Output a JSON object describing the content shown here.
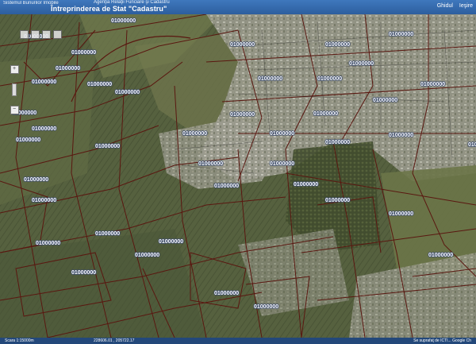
{
  "header": {
    "left_text": "Sistemul Bunurilor Imobile",
    "agency": "Agenţia Relaţii Funciare şi Cadastru",
    "title": "Întreprinderea de Stat \"Cadastru\"",
    "links": [
      "Ghidul",
      "Ieşire"
    ]
  },
  "map": {
    "imagery_colors": {
      "field_dark": "#4f5b3e",
      "field_light": "#7d8456",
      "urban": "#a7a79d",
      "forest": "#3f4a2c",
      "boundary": "#5a1710"
    },
    "parcel_labels": [
      "01000000",
      "01000000",
      "01000000",
      "01000000",
      "01000000",
      "01000000",
      "01000000",
      "01000000",
      "01000000",
      "01000000",
      "01000000",
      "01000000",
      "01000000",
      "01000000",
      "01000000",
      "01000000",
      "01000000",
      "01000000",
      "01000000",
      "01000000",
      "01000000",
      "01000000",
      "01000000",
      "01000000",
      "01000000",
      "01000000",
      "01000000",
      "01000000",
      "01000000",
      "01000000",
      "01000000",
      "01000000",
      "01000000",
      "01000000",
      "01000000",
      "01000000",
      "01000000",
      "01000000",
      "01000000",
      "01000000",
      "01000000",
      "01000000"
    ]
  },
  "status": {
    "scale": "Scara 1:15000m",
    "coords": "228606.01 , 205722.17",
    "note": "Se suprafaţ de ICTI... Google Ch"
  }
}
